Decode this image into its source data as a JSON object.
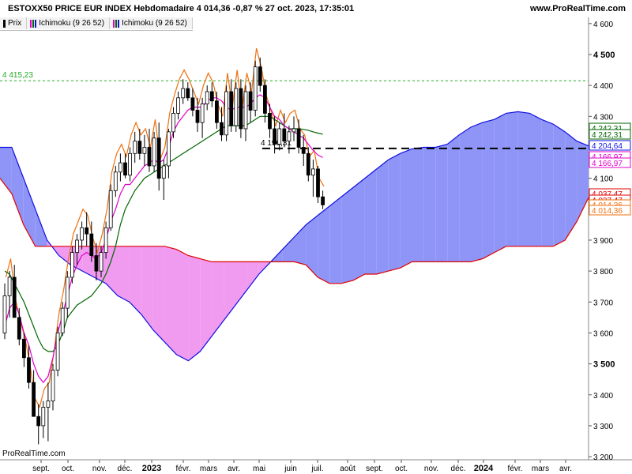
{
  "header": {
    "title": "ESTOXX50 PRICE EUR INDEX Hebdomadaire 4 014,36 -0,87 % 27 oct. 2023, 17:35:01",
    "site": "www.ProRealTime.com"
  },
  "tabs": [
    {
      "label": "Prix"
    },
    {
      "label": "Ichimoku (9 26 52)"
    },
    {
      "label": "Ichimoku (9 26 52)"
    }
  ],
  "watermark": "ProRealTime.com",
  "colors": {
    "cloud_bull": "#8f95f7",
    "cloud_bear": "#f09af0",
    "span_a": "#1010e0",
    "span_b": "#e00000",
    "tenkan": "#e000c8",
    "kijun": "#006600",
    "chikou": "#f07010",
    "candle_up": "#ffffff",
    "candle_down": "#000000",
    "dashed_level": "#22aa22"
  },
  "chart_data": {
    "type": "candlestick",
    "title": "ESTOXX50 PRICE EUR INDEX Hebdomadaire",
    "ylim": [
      3190,
      4620
    ],
    "y_ticks": [
      "3 200",
      "3 300",
      "3 400",
      "3 500",
      "3 600",
      "3 700",
      "3 800",
      "3 900",
      "4 000",
      "4 100",
      "4 200",
      "4 300",
      "4 400",
      "4 500",
      "4 600"
    ],
    "bold_ticks": [
      "3 500",
      "4 500"
    ],
    "x_labels": [
      "sept.",
      "oct.",
      "nov.",
      "déc.",
      "2023",
      "févr.",
      "mars",
      "avr.",
      "mai",
      "juin",
      "juil.",
      "août",
      "sept.",
      "oct.",
      "nov.",
      "déc.",
      "2024",
      "févr.",
      "mars",
      "avr."
    ],
    "bold_x_labels": [
      "2023",
      "2024"
    ],
    "levels": [
      {
        "value": 4415.23,
        "label": "4 415,23",
        "style": "dashed-green"
      },
      {
        "value": 4196.31,
        "label": "4 196,31",
        "style": "dashed-black"
      }
    ],
    "last_values": [
      {
        "value": 4242.31,
        "label": "4 242,31",
        "color": "#006600"
      },
      {
        "value": 4242.31,
        "label": "4 242,31",
        "color": "#006600"
      },
      {
        "value": 4204.64,
        "label": "4 204,64",
        "color": "#1010e0"
      },
      {
        "value": 4166.97,
        "label": "4 166,97",
        "color": "#e000c8"
      },
      {
        "value": 4166.97,
        "label": "4 166,97",
        "color": "#e000c8"
      },
      {
        "value": 4037.47,
        "label": "4 037,47",
        "color": "#e00000"
      },
      {
        "value": 4037.47,
        "label": "4 037,47",
        "color": "#e00000"
      },
      {
        "value": 4014.36,
        "label": "4 014,36",
        "color": "#f07010"
      },
      {
        "value": 4014.36,
        "label": "4 014,36",
        "color": "#f07010"
      }
    ],
    "candles": [
      [
        3600,
        3760,
        3580,
        3720
      ],
      [
        3720,
        3800,
        3650,
        3780
      ],
      [
        3780,
        3820,
        3700,
        3650
      ],
      [
        3650,
        3680,
        3560,
        3580
      ],
      [
        3580,
        3600,
        3490,
        3520
      ],
      [
        3520,
        3560,
        3420,
        3440
      ],
      [
        3440,
        3480,
        3340,
        3330
      ],
      [
        3330,
        3370,
        3240,
        3300
      ],
      [
        3300,
        3380,
        3260,
        3360
      ],
      [
        3360,
        3440,
        3250,
        3380
      ],
      [
        3380,
        3500,
        3350,
        3480
      ],
      [
        3480,
        3620,
        3460,
        3600
      ],
      [
        3600,
        3700,
        3590,
        3680
      ],
      [
        3680,
        3800,
        3650,
        3780
      ],
      [
        3780,
        3880,
        3760,
        3860
      ],
      [
        3860,
        3920,
        3820,
        3900
      ],
      [
        3900,
        3960,
        3870,
        3940
      ],
      [
        3940,
        3990,
        3880,
        3920
      ],
      [
        3920,
        3960,
        3830,
        3850
      ],
      [
        3850,
        3890,
        3770,
        3800
      ],
      [
        3800,
        3880,
        3780,
        3860
      ],
      [
        3860,
        3960,
        3840,
        3940
      ],
      [
        3940,
        4080,
        3930,
        4060
      ],
      [
        4060,
        4140,
        4040,
        4120
      ],
      [
        4120,
        4180,
        4090,
        4150
      ],
      [
        4150,
        4180,
        4100,
        4110
      ],
      [
        4110,
        4200,
        4090,
        4180
      ],
      [
        4180,
        4250,
        4150,
        4220
      ],
      [
        4220,
        4260,
        4160,
        4180
      ],
      [
        4180,
        4240,
        4140,
        4200
      ],
      [
        4200,
        4260,
        4120,
        4140
      ],
      [
        4140,
        4250,
        4120,
        4230
      ],
      [
        4230,
        4280,
        4060,
        4100
      ],
      [
        4100,
        4160,
        4030,
        4140
      ],
      [
        4140,
        4260,
        4100,
        4250
      ],
      [
        4250,
        4330,
        4230,
        4310
      ],
      [
        4310,
        4380,
        4290,
        4360
      ],
      [
        4360,
        4420,
        4340,
        4390
      ],
      [
        4390,
        4410,
        4350,
        4360
      ],
      [
        4360,
        4390,
        4300,
        4320
      ],
      [
        4320,
        4360,
        4250,
        4280
      ],
      [
        4280,
        4360,
        4230,
        4340
      ],
      [
        4340,
        4400,
        4320,
        4380
      ],
      [
        4380,
        4410,
        4330,
        4350
      ],
      [
        4350,
        4380,
        4260,
        4280
      ],
      [
        4280,
        4330,
        4220,
        4240
      ],
      [
        4240,
        4400,
        4220,
        4380
      ],
      [
        4380,
        4420,
        4250,
        4270
      ],
      [
        4270,
        4410,
        4250,
        4390
      ],
      [
        4390,
        4420,
        4230,
        4260
      ],
      [
        4260,
        4400,
        4220,
        4380
      ],
      [
        4380,
        4410,
        4280,
        4320
      ],
      [
        4320,
        4480,
        4300,
        4460
      ],
      [
        4460,
        4490,
        4380,
        4400
      ],
      [
        4400,
        4420,
        4280,
        4310
      ],
      [
        4310,
        4340,
        4230,
        4260
      ],
      [
        4260,
        4300,
        4180,
        4210
      ],
      [
        4210,
        4280,
        4190,
        4260
      ],
      [
        4260,
        4310,
        4200,
        4220
      ],
      [
        4220,
        4270,
        4180,
        4250
      ],
      [
        4250,
        4300,
        4220,
        4260
      ],
      [
        4260,
        4290,
        4180,
        4200
      ],
      [
        4200,
        4240,
        4140,
        4180
      ],
      [
        4180,
        4200,
        4090,
        4110
      ],
      [
        4110,
        4160,
        4040,
        4130
      ],
      [
        4130,
        4140,
        4020,
        4040
      ],
      [
        4040,
        4060,
        4000,
        4014
      ]
    ],
    "tenkan": [
      3620,
      3680,
      3700,
      3660,
      3600,
      3560,
      3500,
      3460,
      3440,
      3460,
      3520,
      3600,
      3660,
      3720,
      3780,
      3820,
      3850,
      3860,
      3850,
      3840,
      3860,
      3900,
      3960,
      4000,
      4050,
      4080,
      4080,
      4100,
      4120,
      4140,
      4150,
      4160,
      4150,
      4160,
      4200,
      4250,
      4280,
      4300,
      4320,
      4330,
      4330,
      4330,
      4350,
      4360,
      4360,
      4350,
      4330,
      4320,
      4330,
      4330,
      4330,
      4340,
      4360,
      4370,
      4360,
      4330,
      4300,
      4290,
      4270,
      4260,
      4250,
      4240,
      4230,
      4210,
      4190,
      4175,
      4166.97
    ],
    "kijun": [
      3800,
      3790,
      3760,
      3730,
      3700,
      3660,
      3620,
      3580,
      3550,
      3540,
      3540,
      3560,
      3600,
      3650,
      3670,
      3690,
      3700,
      3710,
      3720,
      3740,
      3760,
      3790,
      3830,
      3880,
      3950,
      4000,
      4030,
      4060,
      4080,
      4100,
      4110,
      4120,
      4130,
      4140,
      4150,
      4160,
      4170,
      4180,
      4190,
      4200,
      4210,
      4220,
      4230,
      4240,
      4250,
      4260,
      4270,
      4270,
      4270,
      4270,
      4270,
      4280,
      4290,
      4300,
      4300,
      4300,
      4290,
      4280,
      4270,
      4260,
      4260,
      4260,
      4258,
      4255,
      4250,
      4246,
      4242.31
    ],
    "chikou_offset": 26,
    "cloud": {
      "span_a": [
        4200,
        4200,
        4100,
        4000,
        3900,
        3850,
        3820,
        3800,
        3780,
        3760,
        3720,
        3700,
        3660,
        3610,
        3570,
        3530,
        3510,
        3540,
        3590,
        3640,
        3690,
        3740,
        3790,
        3830,
        3870,
        3910,
        3950,
        3980,
        4010,
        4040,
        4070,
        4100,
        4130,
        4160,
        4180,
        4195,
        4200,
        4200,
        4210,
        4240,
        4265,
        4280,
        4290,
        4310,
        4315,
        4310,
        4290,
        4275,
        4250,
        4220,
        4204.64
      ],
      "span_b": [
        4100,
        4050,
        3950,
        3880,
        3880,
        3880,
        3880,
        3880,
        3880,
        3880,
        3880,
        3880,
        3880,
        3880,
        3880,
        3870,
        3850,
        3840,
        3830,
        3830,
        3830,
        3830,
        3830,
        3830,
        3830,
        3830,
        3820,
        3780,
        3760,
        3760,
        3770,
        3790,
        3790,
        3800,
        3810,
        3830,
        3830,
        3830,
        3830,
        3830,
        3830,
        3840,
        3860,
        3880,
        3880,
        3880,
        3880,
        3880,
        3900,
        3960,
        4037.47
      ]
    }
  }
}
